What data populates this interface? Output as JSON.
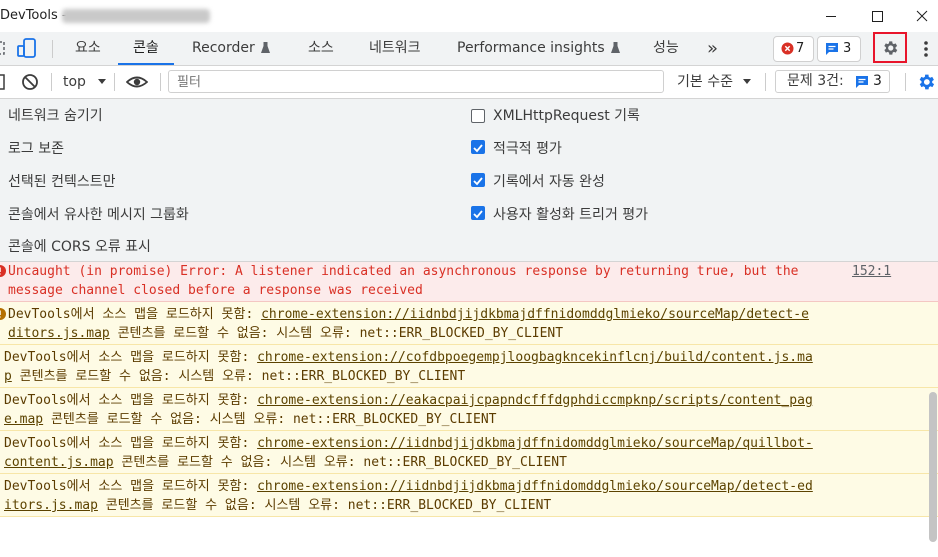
{
  "window": {
    "title": "DevTools - "
  },
  "tabs": {
    "elements": "요소",
    "console": "콘솔",
    "recorder": "Recorder",
    "sources": "소스",
    "network": "네트워크",
    "performance_insights": "Performance insights",
    "performance": "성능",
    "more": "»"
  },
  "counters": {
    "errors": "7",
    "messages": "3"
  },
  "toolbar": {
    "context": "top",
    "filter_placeholder": "필터",
    "level": "기본 수준",
    "issues_label": "문제 3건:",
    "issues_count": "3"
  },
  "settings": {
    "left": [
      {
        "label": "네트워크 숨기기"
      },
      {
        "label": "로그 보존"
      },
      {
        "label": "선택된 컨텍스트만"
      },
      {
        "label": "콘솔에서 유사한 메시지 그룹화"
      },
      {
        "label": "콘솔에 CORS 오류 표시"
      }
    ],
    "right": [
      {
        "label": "XMLHttpRequest 기록",
        "checked": false
      },
      {
        "label": "적극적 평가",
        "checked": true
      },
      {
        "label": "기록에서 자동 완성",
        "checked": true
      },
      {
        "label": "사용자 활성화 트리거 평가",
        "checked": true
      }
    ]
  },
  "messages": [
    {
      "level": "error",
      "line1": "Uncaught (in promise) Error: A listener indicated an asynchronous response by returning true, but the",
      "source": "152:1",
      "line2": "message channel closed before a response was received"
    },
    {
      "level": "warning",
      "prefix": "DevTools에서 소스 맵을 로드하지 못함: ",
      "link1": "chrome-extension://iidnbdjijdkbmajdffnidomddglmieko/sourceMap/detect-e",
      "link2": "ditors.js.map",
      "suffix": " 콘텐츠를 로드할 수 없음: 시스템 오류: net::ERR_BLOCKED_BY_CLIENT"
    },
    {
      "level": "warning",
      "prefix": "DevTools에서 소스 맵을 로드하지 못함: ",
      "link1": "chrome-extension://cofdbpoegempjloogbagkncekinflcnj/build/content.js.ma",
      "link2": "p",
      "suffix": " 콘텐츠를 로드할 수 없음: 시스템 오류: net::ERR_BLOCKED_BY_CLIENT"
    },
    {
      "level": "warning",
      "prefix": "DevTools에서 소스 맵을 로드하지 못함: ",
      "link1": "chrome-extension://eakacpaijcpapndcfffdgphdiccmpknp/scripts/content_pag",
      "link2": "e.map",
      "suffix": " 콘텐츠를 로드할 수 없음: 시스템 오류: net::ERR_BLOCKED_BY_CLIENT"
    },
    {
      "level": "warning",
      "prefix": "DevTools에서 소스 맵을 로드하지 못함: ",
      "link1": "chrome-extension://iidnbdjijdkbmajdffnidomddglmieko/sourceMap/quillbot-",
      "link2": "content.js.map",
      "suffix": " 콘텐츠를 로드할 수 없음: 시스템 오류: net::ERR_BLOCKED_BY_CLIENT"
    },
    {
      "level": "warning",
      "prefix": "DevTools에서 소스 맵을 로드하지 못함: ",
      "link1": "chrome-extension://iidnbdjijdkbmajdffnidomddglmieko/sourceMap/detect-ed",
      "link2": "itors.js.map",
      "suffix": " 콘텐츠를 로드할 수 없음: 시스템 오류: net::ERR_BLOCKED_BY_CLIENT"
    }
  ],
  "colors": {
    "accent": "#1a73e8",
    "error": "#d93025",
    "error_bg": "#fcebeb",
    "warning_bg": "#fefbe5",
    "highlight": "#e8152b"
  },
  "icons": [
    "inspect-icon",
    "device-toolbar-icon",
    "flask-icon",
    "error-circle-icon",
    "message-icon",
    "settings-gear-icon",
    "more-vert-icon",
    "sidebar-icon",
    "clear-console-icon",
    "eye-icon",
    "settings-blue-icon",
    "error-icon",
    "warning-icon"
  ]
}
